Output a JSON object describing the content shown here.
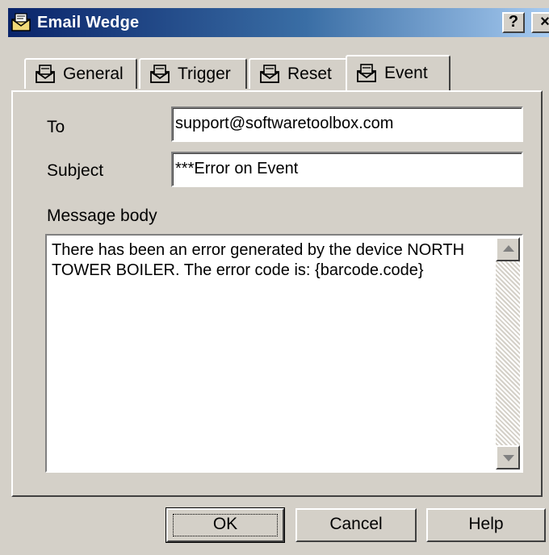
{
  "window": {
    "title": "Email Wedge",
    "help_button": "?",
    "close_button": "×"
  },
  "tabs": [
    {
      "label": "General",
      "active": false
    },
    {
      "label": "Trigger",
      "active": false
    },
    {
      "label": "Reset",
      "active": false
    },
    {
      "label": "Event",
      "active": true
    }
  ],
  "form": {
    "to_label": "To",
    "to_value": "support@softwaretoolbox.com",
    "subject_label": "Subject",
    "subject_value": "***Error on Event",
    "body_label": "Message body",
    "body_value": "There has been an error generated by the device NORTH\nTOWER BOILER. The error code is: {barcode.code}"
  },
  "buttons": {
    "ok": "OK",
    "cancel": "Cancel",
    "help": "Help"
  },
  "colors": {
    "titlebar_start": "#0a246a",
    "titlebar_end": "#a6caf0",
    "face": "#d4d0c8"
  }
}
